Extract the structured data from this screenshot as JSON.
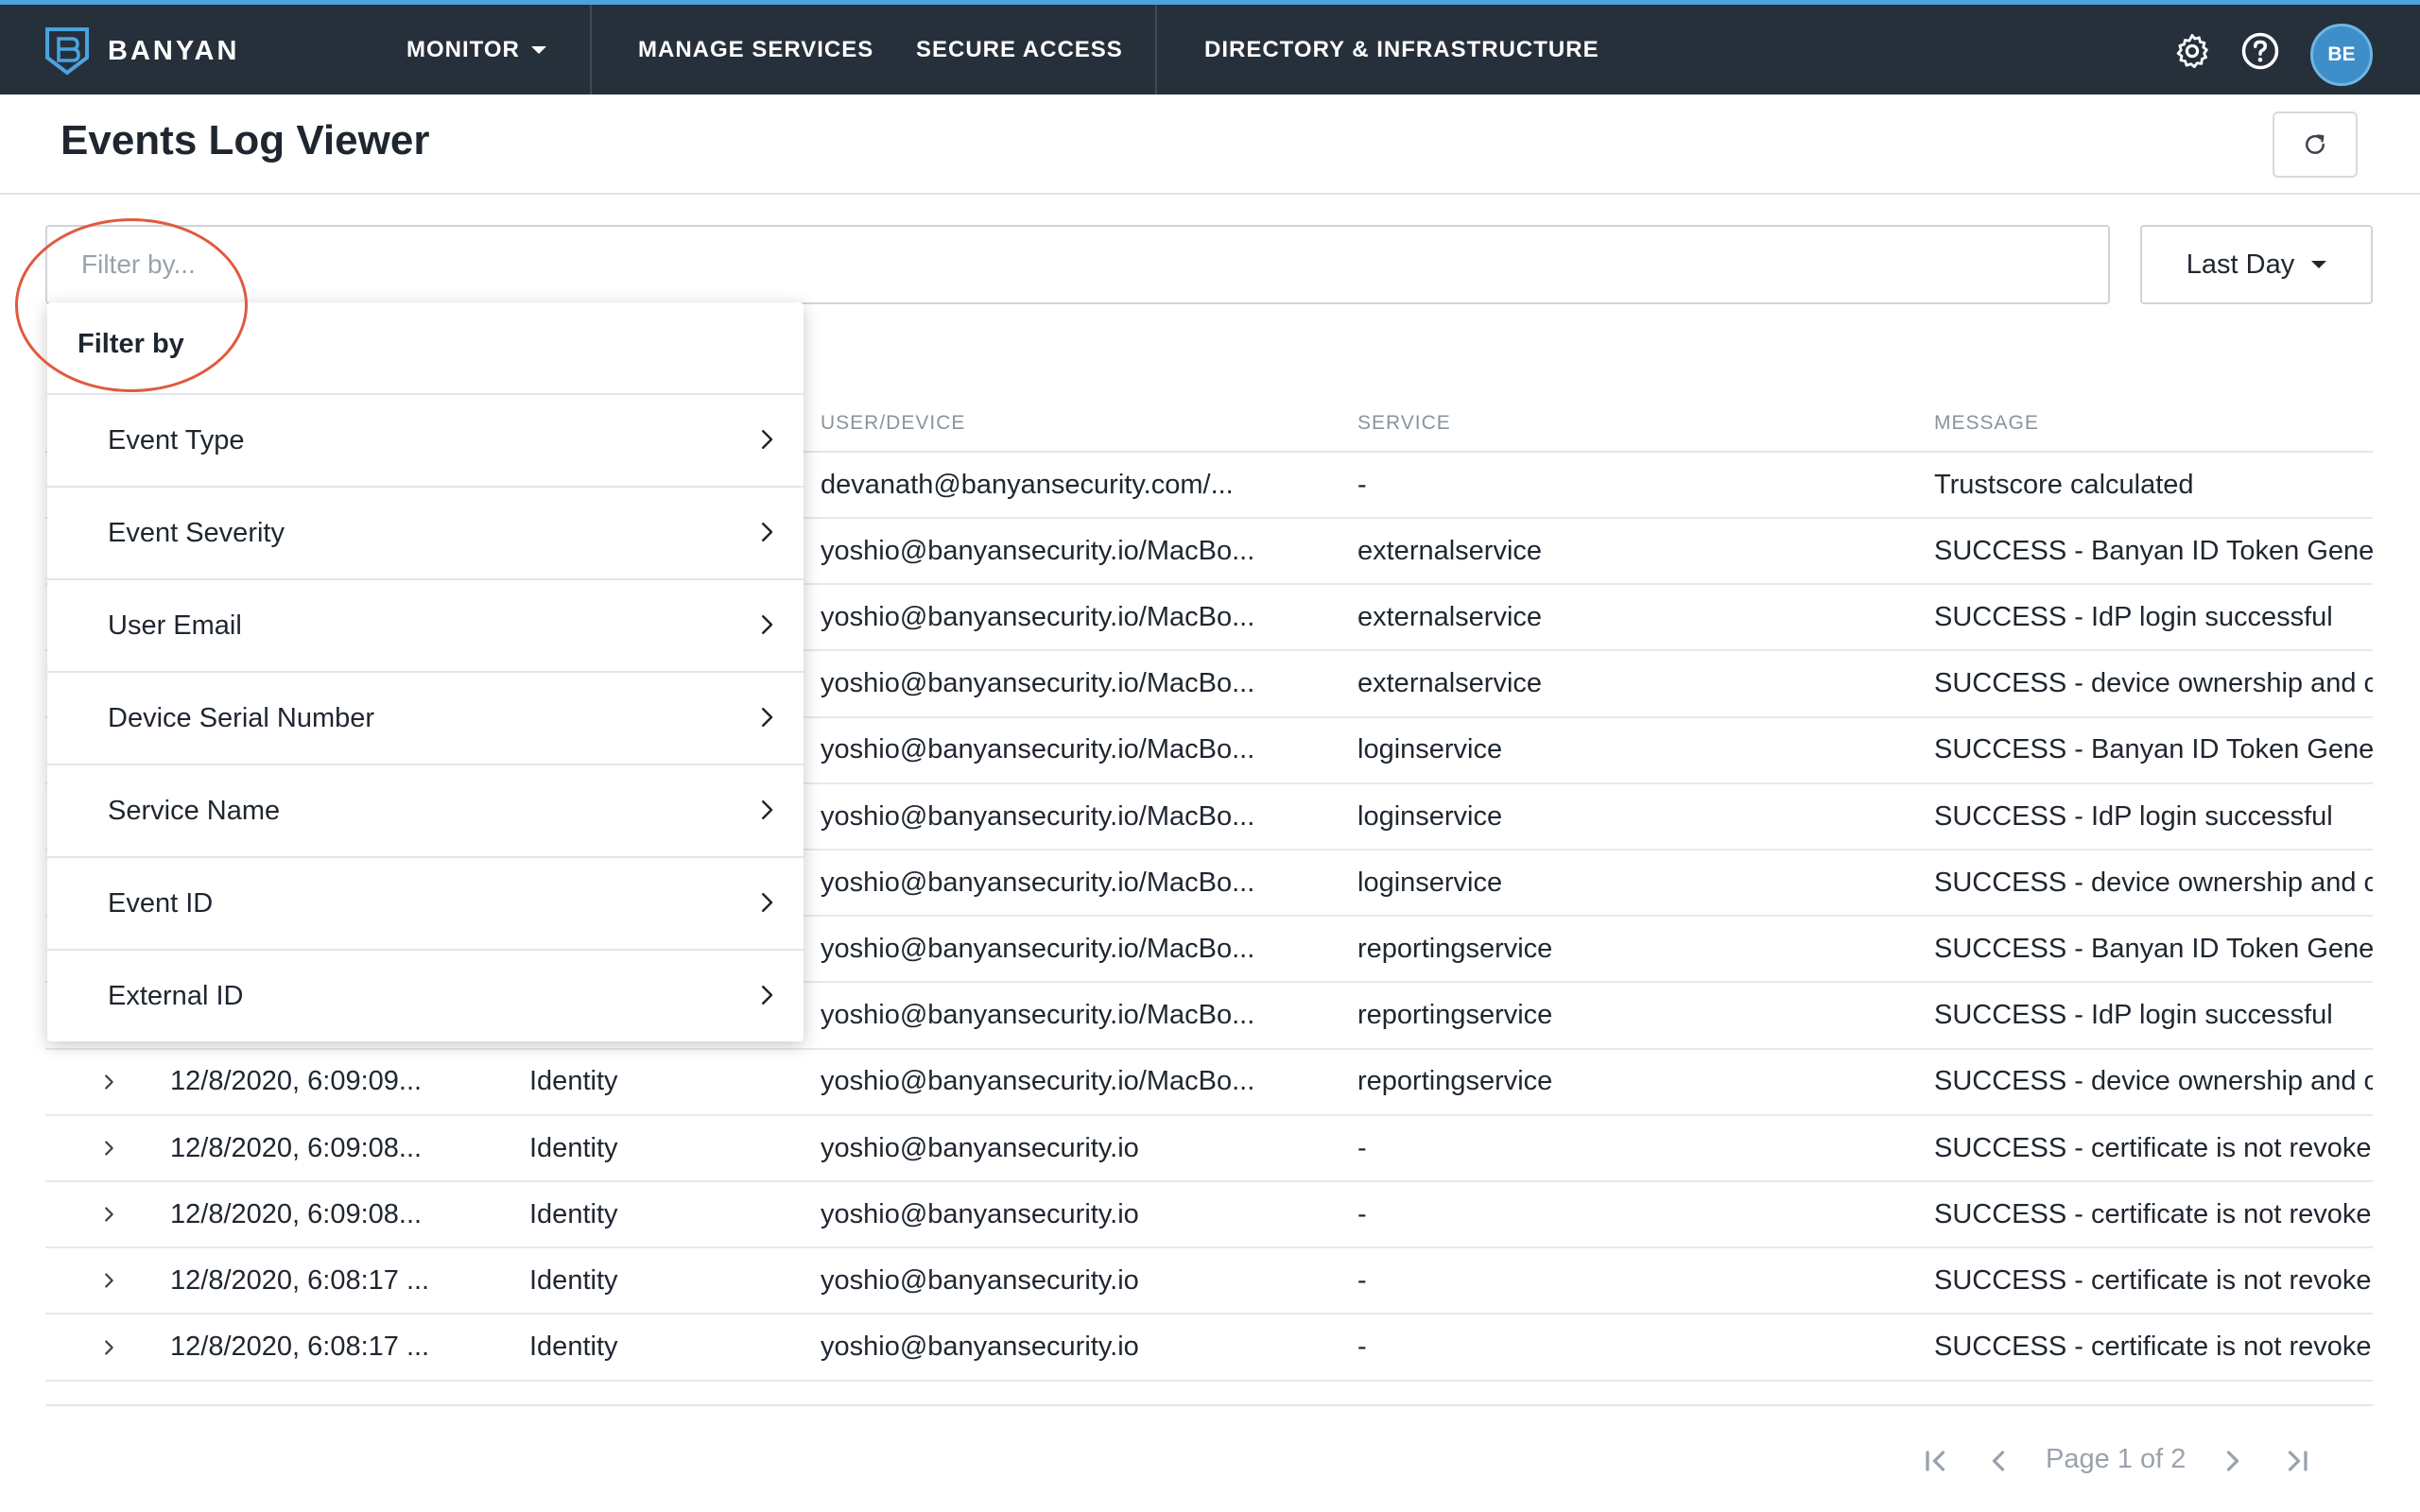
{
  "nav": {
    "brand": "BANYAN",
    "items": [
      {
        "label": "MONITOR"
      },
      {
        "label": "MANAGE SERVICES"
      },
      {
        "label": "SECURE ACCESS"
      },
      {
        "label": "DIRECTORY & INFRASTRUCTURE"
      }
    ],
    "settings_icon": "gear-icon",
    "help_icon": "question-circle-icon",
    "avatar_initials": "BE",
    "accent": "#4aa3df",
    "background": "#26303b"
  },
  "header": {
    "title": "Events Log Viewer",
    "refresh_icon": "refresh-icon"
  },
  "filter": {
    "placeholder": "Filter by...",
    "value": "",
    "range_label": "Last Day"
  },
  "dropdown": {
    "title": "Filter by",
    "items": [
      {
        "label": "Event Type"
      },
      {
        "label": "Event Severity"
      },
      {
        "label": "User Email"
      },
      {
        "label": "Device Serial Number"
      },
      {
        "label": "Service Name"
      },
      {
        "label": "Event ID"
      },
      {
        "label": "External ID"
      }
    ]
  },
  "table": {
    "columns": {
      "user_device": "USER/DEVICE",
      "service": "SERVICE",
      "message": "MESSAGE"
    },
    "rows": [
      {
        "time": "",
        "type": "",
        "user": "devanath@banyansecurity.com/...",
        "service": "-",
        "message": "Trustscore calculated"
      },
      {
        "time": "",
        "type": "",
        "user": "yoshio@banyansecurity.io/MacBo...",
        "service": "externalservice",
        "message": "SUCCESS - Banyan ID Token Gener"
      },
      {
        "time": "",
        "type": "",
        "user": "yoshio@banyansecurity.io/MacBo...",
        "service": "externalservice",
        "message": "SUCCESS - IdP login successful"
      },
      {
        "time": "",
        "type": "",
        "user": "yoshio@banyansecurity.io/MacBo...",
        "service": "externalservice",
        "message": "SUCCESS - device ownership and c"
      },
      {
        "time": "",
        "type": "",
        "user": "yoshio@banyansecurity.io/MacBo...",
        "service": "loginservice",
        "message": "SUCCESS - Banyan ID Token Gener"
      },
      {
        "time": "",
        "type": "",
        "user": "yoshio@banyansecurity.io/MacBo...",
        "service": "loginservice",
        "message": "SUCCESS - IdP login successful"
      },
      {
        "time": "",
        "type": "",
        "user": "yoshio@banyansecurity.io/MacBo...",
        "service": "loginservice",
        "message": "SUCCESS - device ownership and c"
      },
      {
        "time": "",
        "type": "",
        "user": "yoshio@banyansecurity.io/MacBo...",
        "service": "reportingservice",
        "message": "SUCCESS - Banyan ID Token Gener"
      },
      {
        "time": "",
        "type": "",
        "user": "yoshio@banyansecurity.io/MacBo...",
        "service": "reportingservice",
        "message": "SUCCESS - IdP login successful"
      },
      {
        "time": "12/8/2020, 6:09:09...",
        "type": "Identity",
        "user": "yoshio@banyansecurity.io/MacBo...",
        "service": "reportingservice",
        "message": "SUCCESS - device ownership and c"
      },
      {
        "time": "12/8/2020, 6:09:08...",
        "type": "Identity",
        "user": "yoshio@banyansecurity.io",
        "service": "-",
        "message": "SUCCESS - certificate is not revoke"
      },
      {
        "time": "12/8/2020, 6:09:08...",
        "type": "Identity",
        "user": "yoshio@banyansecurity.io",
        "service": "-",
        "message": "SUCCESS - certificate is not revoke"
      },
      {
        "time": "12/8/2020, 6:08:17 ...",
        "type": "Identity",
        "user": "yoshio@banyansecurity.io",
        "service": "-",
        "message": "SUCCESS - certificate is not revoke"
      },
      {
        "time": "12/8/2020, 6:08:17 ...",
        "type": "Identity",
        "user": "yoshio@banyansecurity.io",
        "service": "-",
        "message": "SUCCESS - certificate is not revoke"
      }
    ]
  },
  "pagination": {
    "label": "Page 1 of 2",
    "first_icon": "first-page-icon",
    "prev_icon": "chevron-left-icon",
    "next_icon": "chevron-right-icon",
    "last_icon": "last-page-icon"
  },
  "annotation_color": "#e05a3f"
}
